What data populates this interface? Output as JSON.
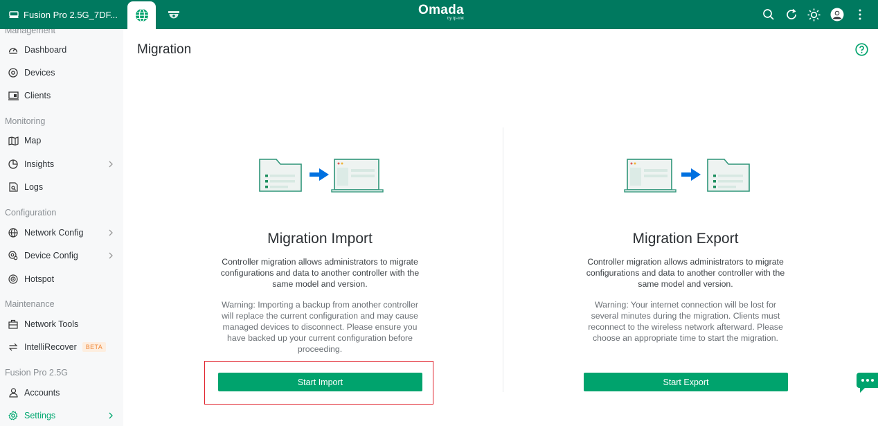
{
  "topbar": {
    "site_name": "Fusion Pro 2.5G_7DF...",
    "brand": "Omada",
    "brand_sub": "by tp-link",
    "accent": "#00795f"
  },
  "sidebar": {
    "sections": [
      {
        "label": "Management",
        "items": [
          {
            "label": "Dashboard",
            "icon": "dashboard-icon"
          },
          {
            "label": "Devices",
            "icon": "devices-icon"
          },
          {
            "label": "Clients",
            "icon": "clients-icon"
          }
        ]
      },
      {
        "label": "Monitoring",
        "items": [
          {
            "label": "Map",
            "icon": "map-icon"
          },
          {
            "label": "Insights",
            "icon": "insights-icon"
          },
          {
            "label": "Logs",
            "icon": "logs-icon"
          }
        ]
      },
      {
        "label": "Configuration",
        "items": [
          {
            "label": "Network Config",
            "icon": "globe-icon"
          },
          {
            "label": "Device Config",
            "icon": "device-config-icon"
          },
          {
            "label": "Hotspot",
            "icon": "hotspot-icon"
          }
        ]
      },
      {
        "label": "Maintenance",
        "items": [
          {
            "label": "Network Tools",
            "icon": "toolbox-icon"
          },
          {
            "label": "IntelliRecover",
            "icon": "sync-icon",
            "badge": "BETA"
          }
        ]
      },
      {
        "label": "Fusion Pro 2.5G",
        "items": [
          {
            "label": "Accounts",
            "icon": "user-icon"
          },
          {
            "label": "Settings",
            "icon": "gear-icon"
          }
        ]
      }
    ]
  },
  "main": {
    "title": "Migration",
    "import": {
      "title": "Migration Import",
      "description": "Controller migration allows administrators to migrate configurations and data to another controller with the same model and version.",
      "warning": "Warning: Importing a backup from another controller will replace the current configuration and may cause managed devices to disconnect. Please ensure you have backed up your current configuration before proceeding.",
      "button": "Start Import"
    },
    "export": {
      "title": "Migration Export",
      "description": "Controller migration allows administrators to migrate configurations and data to another controller with the same model and version.",
      "warning": "Warning: Your internet connection will be lost for several minutes during the migration. Clients must reconnect to the wireless network afterward. Please choose an appropriate time to start the migration.",
      "button": "Start Export"
    }
  }
}
